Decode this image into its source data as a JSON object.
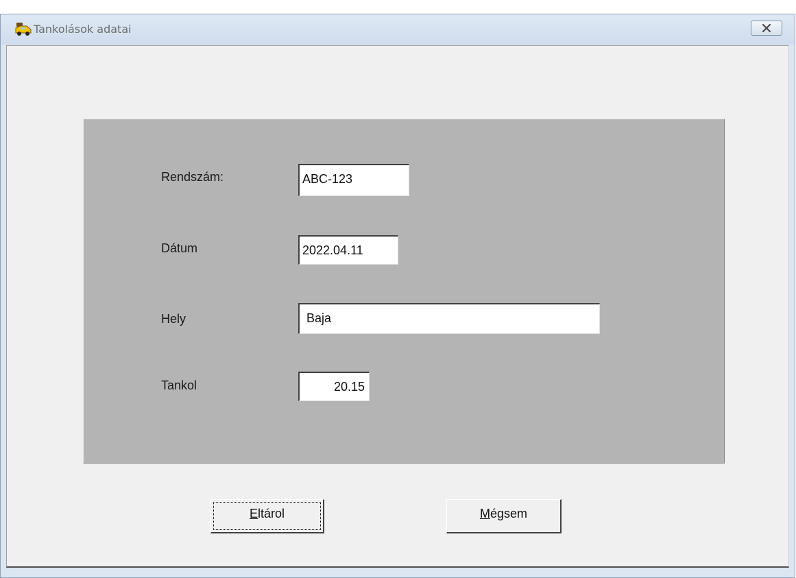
{
  "window": {
    "title": "Tankolások adatai",
    "icon": "fuel-car-icon",
    "close_icon": "close-icon"
  },
  "form": {
    "rendszam": {
      "label": "Rendszám:",
      "value": "ABC-123"
    },
    "datum": {
      "label": "Dátum",
      "value": "2022.04.11"
    },
    "hely": {
      "label": "Hely",
      "value": "Baja"
    },
    "tankol": {
      "label": "Tankol",
      "value": "20.15"
    }
  },
  "buttons": {
    "save": {
      "mnemonic": "E",
      "rest": "ltárol"
    },
    "cancel": {
      "mnemonic": "M",
      "rest": "égsem"
    }
  }
}
